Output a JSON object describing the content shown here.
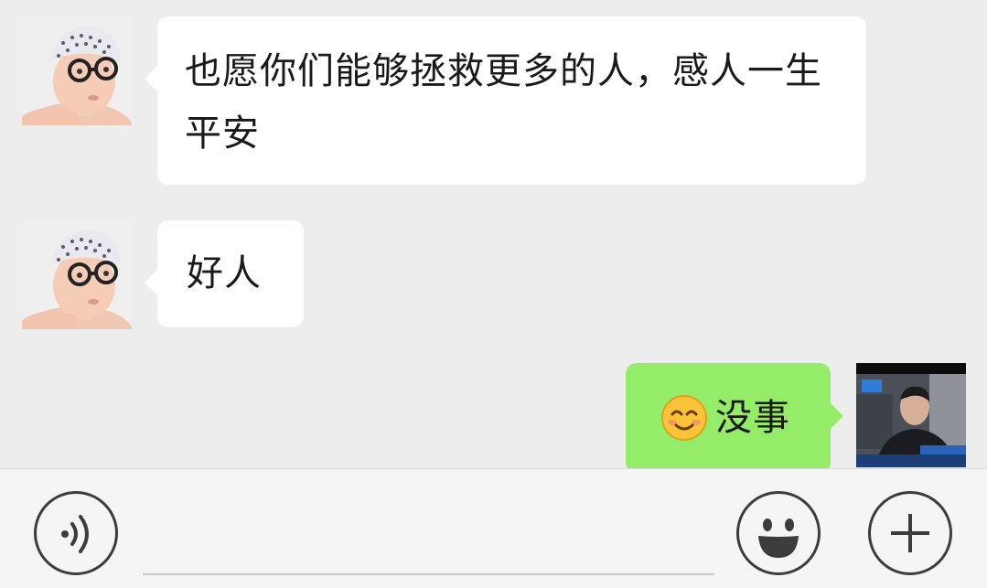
{
  "messages": [
    {
      "sender": "other",
      "text": "也愿你们能够拯救更多的人，感人一生平安"
    },
    {
      "sender": "other",
      "text": "好人"
    },
    {
      "sender": "me",
      "emoji": "smiling-face",
      "text": "没事"
    }
  ],
  "input_bar": {
    "voice_icon": "voice-icon",
    "emoji_icon": "emoji-icon",
    "more_icon": "plus-icon",
    "placeholder": ""
  },
  "colors": {
    "background": "#ededed",
    "incoming_bubble": "#ffffff",
    "outgoing_bubble": "#95ec69",
    "input_bar": "#f5f5f5"
  }
}
